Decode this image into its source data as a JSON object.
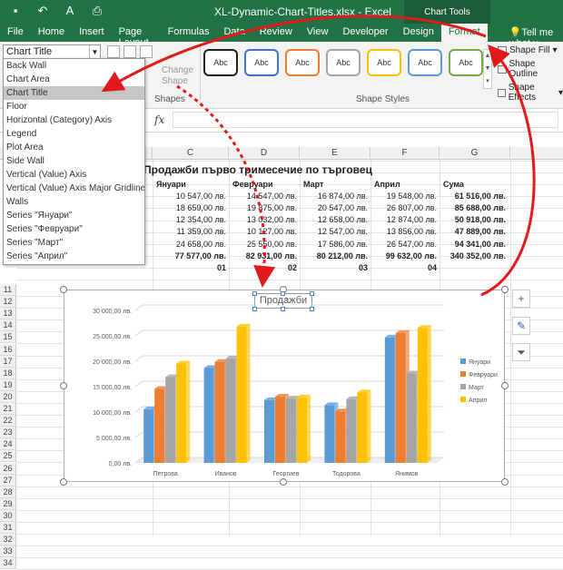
{
  "window": {
    "title": "XL-Dynamic-Chart-Titles.xlsx - Excel",
    "context_tab_group": "Chart Tools"
  },
  "tabs": [
    "File",
    "Home",
    "Insert",
    "Page Layout",
    "Formulas",
    "Data",
    "Review",
    "View",
    "Developer",
    "Design",
    "Format"
  ],
  "tell_me": "Tell me what y",
  "ribbon": {
    "namebox_value": "Chart Title",
    "change_shape": "Change Shape",
    "shapes_group": "Shapes",
    "shape_styles_label": "Shape Styles",
    "style_sample": "Abc",
    "shape_fill": "Shape Fill",
    "shape_outline": "Shape Outline",
    "shape_effects": "Shape Effects",
    "fx": "fx"
  },
  "dropdown_items": [
    "Back Wall",
    "Chart Area",
    "Chart Title",
    "Floor",
    "Horizontal (Category) Axis",
    "Legend",
    "Plot Area",
    "Side Wall",
    "Vertical (Value) Axis",
    "Vertical (Value) Axis Major Gridlines",
    "Walls",
    "Series \"Януари\"",
    "Series \"Февруари\"",
    "Series \"Март\"",
    "Series \"Април\""
  ],
  "columns": [
    "C",
    "D",
    "E",
    "F",
    "G"
  ],
  "rows": [
    "11",
    "12",
    "13",
    "14",
    "15",
    "16",
    "17",
    "18",
    "19",
    "20",
    "21",
    "22",
    "23",
    "24",
    "25",
    "26",
    "27",
    "28",
    "29",
    "30",
    "31",
    "32",
    "33",
    "34"
  ],
  "sheet": {
    "title": "Продажби първо тримесечие по търговец",
    "headers": [
      "Януари",
      "Февруари",
      "Март",
      "Април",
      "Сума"
    ],
    "data": [
      [
        "10 547,00 лв.",
        "14 547,00 лв.",
        "16 874,00 лв.",
        "19 548,00 лв.",
        "61 516,00 лв."
      ],
      [
        "18 659,00 лв.",
        "19 875,00 лв.",
        "20 547,00 лв.",
        "26 807,00 лв.",
        "85 688,00 лв."
      ],
      [
        "12 354,00 лв.",
        "13 032,00 лв.",
        "12 658,00 лв.",
        "12 874,00 лв.",
        "50 918,00 лв."
      ],
      [
        "11 359,00 лв.",
        "10 127,00 лв.",
        "12 547,00 лв.",
        "13 856,00 лв.",
        "47 889,00 лв."
      ],
      [
        "24 658,00 лв.",
        "25 550,00 лв.",
        "17 586,00 лв.",
        "26 547,00 лв.",
        "94 341,00 лв."
      ],
      [
        "77 577,00 лв.",
        "82 931,00 лв.",
        "80 212,00 лв.",
        "99 632,00 лв.",
        "340 352,00 лв."
      ]
    ],
    "month_numbers": [
      "01",
      "02",
      "03",
      "04"
    ]
  },
  "chart_data": {
    "type": "bar",
    "title": "Продажби",
    "categories": [
      "Петрова",
      "Иванов",
      "Георгиев",
      "Тодорова",
      "Янимов"
    ],
    "series": [
      {
        "name": "Януари",
        "color": "#5b9bd5",
        "values": [
          10547,
          18659,
          12354,
          11359,
          24658
        ]
      },
      {
        "name": "Февруари",
        "color": "#ed7d31",
        "values": [
          14547,
          19875,
          13032,
          10127,
          25550
        ]
      },
      {
        "name": "Март",
        "color": "#a5a5a5",
        "values": [
          16874,
          20547,
          12658,
          12547,
          17586
        ]
      },
      {
        "name": "Април",
        "color": "#ffc000",
        "values": [
          19548,
          26807,
          12874,
          13856,
          26547
        ]
      }
    ],
    "yticks": [
      "0,00 лв.",
      "5 000,00 лв.",
      "10 000,00 лв.",
      "15 000,00 лв.",
      "20 000,00 лв.",
      "25 000,00 лв.",
      "30 000,00 лв."
    ],
    "ylim": [
      0,
      30000
    ],
    "legend": "right"
  },
  "colors": {
    "excel_green": "#217346",
    "arrow_red": "#e31a1c"
  }
}
